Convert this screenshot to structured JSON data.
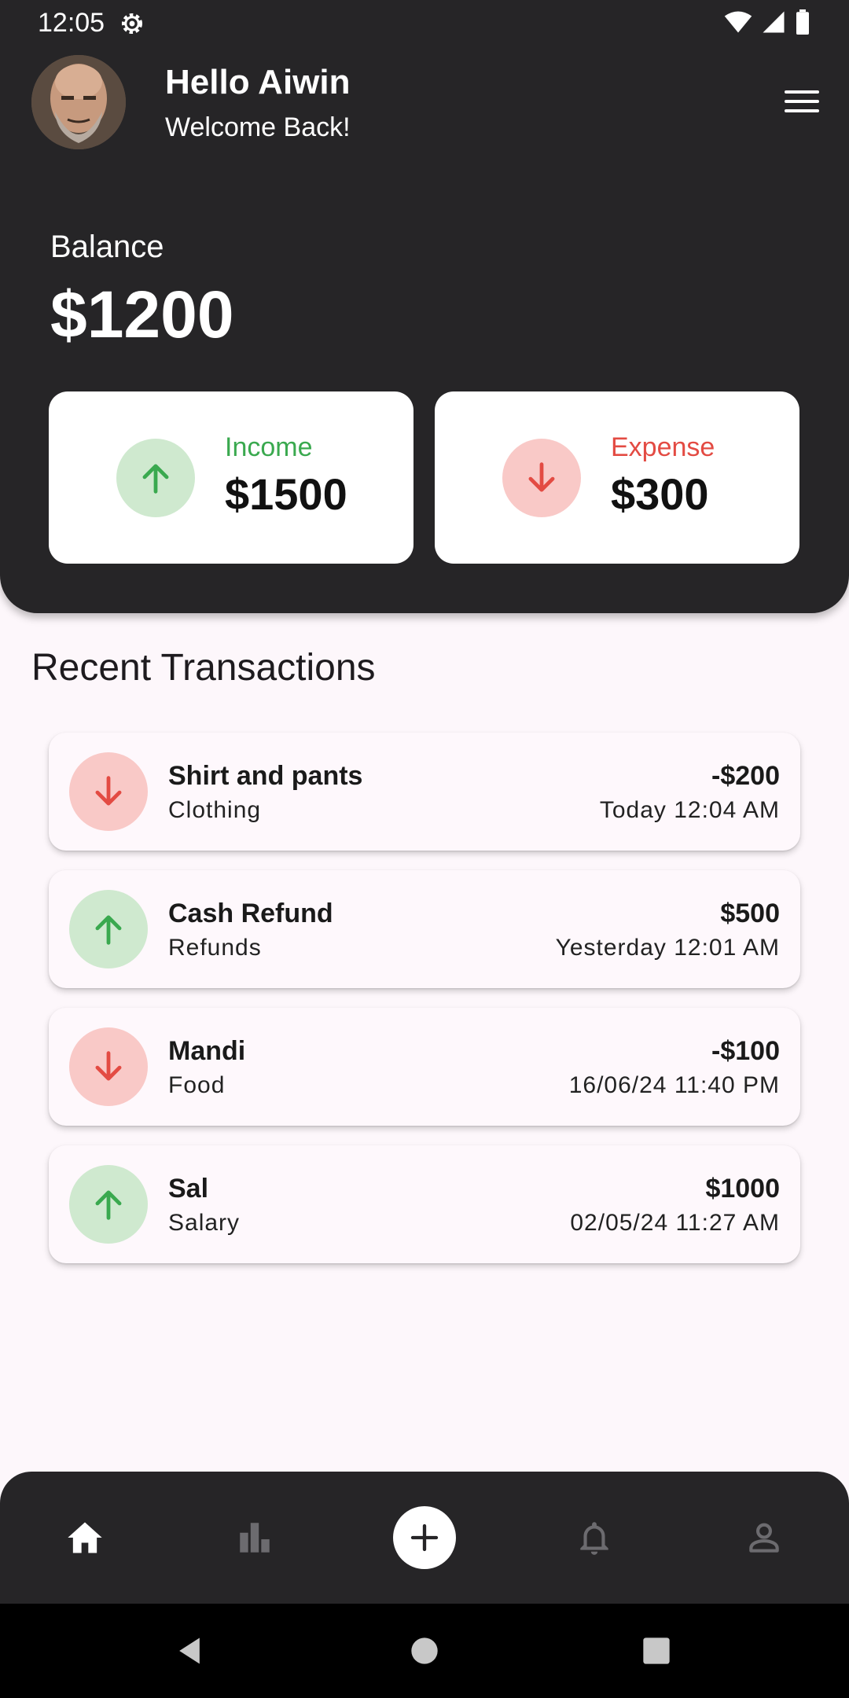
{
  "status_bar": {
    "time": "12:05"
  },
  "header": {
    "greeting": "Hello Aiwin",
    "subtitle": "Welcome Back!",
    "balance_label": "Balance",
    "balance_value": "$1200"
  },
  "summary": {
    "income": {
      "label": "Income",
      "value": "$1500",
      "color": "#3aa94f"
    },
    "expense": {
      "label": "Expense",
      "value": "$300",
      "color": "#e34b43"
    }
  },
  "transactions": {
    "title": "Recent Transactions",
    "items": [
      {
        "title": "Shirt and pants",
        "category": "Clothing",
        "amount": "-$200",
        "time": "Today 12:04 AM",
        "type": "expense"
      },
      {
        "title": "Cash Refund",
        "category": "Refunds",
        "amount": "$500",
        "time": "Yesterday 12:01 AM",
        "type": "income"
      },
      {
        "title": "Mandi",
        "category": "Food",
        "amount": "-$100",
        "time": "16/06/24 11:40 PM",
        "type": "expense"
      },
      {
        "title": "Sal",
        "category": "Salary",
        "amount": "$1000",
        "time": "02/05/24 11:27 AM",
        "type": "income"
      }
    ]
  },
  "bottom_nav": {
    "items": [
      "home-icon",
      "stats-icon",
      "add-icon",
      "bell-icon",
      "profile-icon"
    ],
    "active": "home-icon"
  },
  "colors": {
    "dark": "#262527",
    "green_soft": "#cfe9cf",
    "red_soft": "#f9c9c7"
  }
}
